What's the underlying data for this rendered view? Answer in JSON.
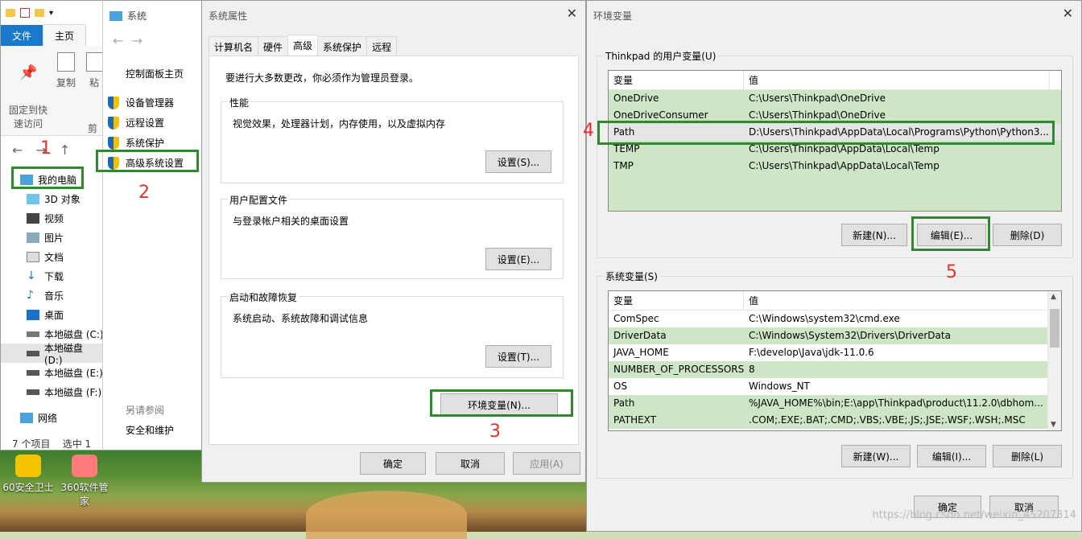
{
  "explorer": {
    "ribbon_tabs": [
      "文件",
      "主页"
    ],
    "ribbon_buttons": [
      "固定到快\n速访问",
      "复制",
      "粘",
      "剪"
    ],
    "tree": [
      {
        "label": "我的电脑",
        "top": true
      },
      {
        "label": "3D 对象"
      },
      {
        "label": "视频"
      },
      {
        "label": "图片"
      },
      {
        "label": "文档"
      },
      {
        "label": "下载"
      },
      {
        "label": "音乐"
      },
      {
        "label": "桌面"
      },
      {
        "label": "本地磁盘 (C:)"
      },
      {
        "label": "本地磁盘 (D:)",
        "selected": true
      },
      {
        "label": "本地磁盘 (E:)"
      },
      {
        "label": "本地磁盘 (F:)"
      },
      {
        "label": "网络",
        "top": true
      }
    ],
    "status_items": "7 个项目",
    "status_selected": "选中 1"
  },
  "system": {
    "title": "系统",
    "home_link": "控制面板主页",
    "links": [
      "设备管理器",
      "远程设置",
      "系统保护",
      "高级系统设置"
    ],
    "see_also": "另请参阅",
    "security": "安全和维护"
  },
  "props": {
    "title": "系统属性",
    "tabs": [
      "计算机名",
      "硬件",
      "高级",
      "系统保护",
      "远程"
    ],
    "admin_note": "要进行大多数更改，你必须作为管理员登录。",
    "perf_title": "性能",
    "perf_desc": "视觉效果，处理器计划，内存使用，以及虚拟内存",
    "perf_btn": "设置(S)...",
    "profile_title": "用户配置文件",
    "profile_desc": "与登录帐户相关的桌面设置",
    "profile_btn": "设置(E)...",
    "startup_title": "启动和故障恢复",
    "startup_desc": "系统启动、系统故障和调试信息",
    "startup_btn": "设置(T)...",
    "env_btn": "环境变量(N)...",
    "ok": "确定",
    "cancel": "取消",
    "apply": "应用(A)"
  },
  "env": {
    "title": "环境变量",
    "user_legend": "Thinkpad 的用户变量(U)",
    "col_var": "变量",
    "col_val": "值",
    "user_vars": [
      {
        "name": "OneDrive",
        "value": "C:\\Users\\Thinkpad\\OneDrive"
      },
      {
        "name": "OneDriveConsumer",
        "value": "C:\\Users\\Thinkpad\\OneDrive"
      },
      {
        "name": "Path",
        "value": "D:\\Users\\Thinkpad\\AppData\\Local\\Programs\\Python\\Python3..."
      },
      {
        "name": "TEMP",
        "value": "C:\\Users\\Thinkpad\\AppData\\Local\\Temp"
      },
      {
        "name": "TMP",
        "value": "C:\\Users\\Thinkpad\\AppData\\Local\\Temp"
      }
    ],
    "user_new": "新建(N)...",
    "user_edit": "编辑(E)...",
    "user_delete": "删除(D)",
    "sys_legend": "系统变量(S)",
    "sys_vars": [
      {
        "name": "ComSpec",
        "value": "C:\\Windows\\system32\\cmd.exe"
      },
      {
        "name": "DriverData",
        "value": "C:\\Windows\\System32\\Drivers\\DriverData"
      },
      {
        "name": "JAVA_HOME",
        "value": "F:\\develop\\Java\\jdk-11.0.6"
      },
      {
        "name": "NUMBER_OF_PROCESSORS",
        "value": "8"
      },
      {
        "name": "OS",
        "value": "Windows_NT"
      },
      {
        "name": "Path",
        "value": "%JAVA_HOME%\\bin;E:\\app\\Thinkpad\\product\\11.2.0\\dbhom..."
      },
      {
        "name": "PATHEXT",
        "value": ".COM;.EXE;.BAT;.CMD;.VBS;.VBE;.JS;.JSE;.WSF;.WSH;.MSC"
      }
    ],
    "sys_new": "新建(W)...",
    "sys_edit": "编辑(I)...",
    "sys_delete": "删除(L)",
    "ok": "确定",
    "cancel": "取消"
  },
  "steps": [
    "1",
    "2",
    "3",
    "4",
    "5"
  ],
  "desktop": [
    "60安全卫士",
    "360软件管家"
  ],
  "watermark": "https://blog.csdn.net/weixin_45207314",
  "colors": {
    "highlight": "#2f8a2f",
    "step_number": "#e3322b",
    "list_bg": "#cfe6c6"
  }
}
